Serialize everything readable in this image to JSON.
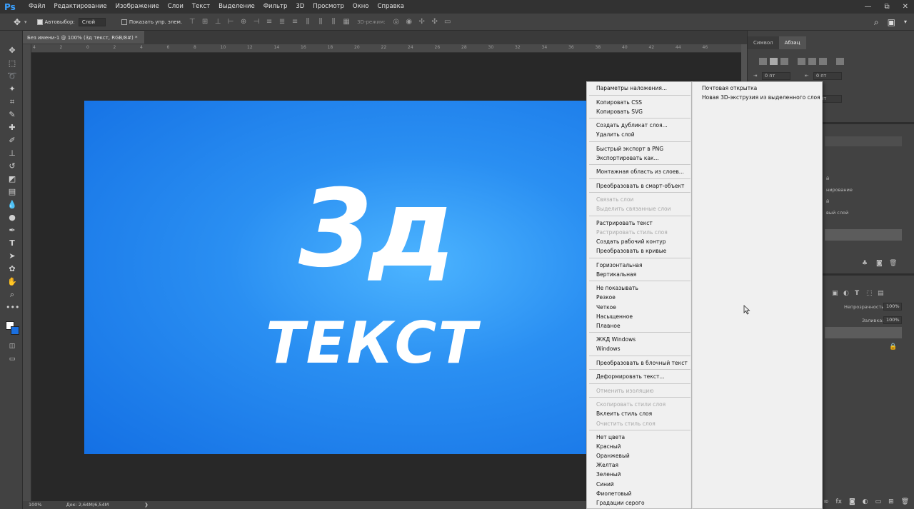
{
  "app": {
    "logo": "Ps",
    "menu": [
      "Файл",
      "Редактирование",
      "Изображение",
      "Слои",
      "Текст",
      "Выделение",
      "Фильтр",
      "3D",
      "Просмотр",
      "Окно",
      "Справка"
    ],
    "window_controls": [
      "—",
      "⧉",
      "✕"
    ]
  },
  "options_bar": {
    "autoselect_label": "Автовыбор:",
    "autoselect_value": "Слой",
    "show_controls_label": "Показать упр. элем.",
    "mode_3d_label": "3D-режим:"
  },
  "document": {
    "tab_title": "Без имени-1 @ 100% (3д текст, RGB/8#) *",
    "ruler_labels": [
      "4",
      "2",
      "0",
      "2",
      "4",
      "6",
      "8",
      "10",
      "12",
      "14",
      "16",
      "18",
      "20",
      "22",
      "24",
      "26",
      "28",
      "30",
      "32",
      "34",
      "36",
      "38",
      "40",
      "42",
      "44",
      "46"
    ],
    "art_line1": "3д",
    "art_line2": "ТЕКСТ",
    "colors": {
      "art_bg_center": "#4cb4ff",
      "art_bg_edge": "#1470e4",
      "art_text": "#ffffff"
    }
  },
  "status_bar": {
    "zoom": "100%",
    "doc_size": "Док: 2,64M/6,54M"
  },
  "right_panel": {
    "tabs": [
      "Символ",
      "Абзац"
    ],
    "active_tab": "Абзац",
    "indent_left": "0 пт",
    "indent_right": "0 пт",
    "indent_first": "0 пт",
    "fragments": [
      "й",
      "нирование",
      "й",
      "вый слой"
    ],
    "opacity_label": "Непрозрачность:",
    "opacity_value": "100%",
    "fill_label": "Заливка:",
    "fill_value": "100%"
  },
  "context_menu": {
    "groups": [
      [
        {
          "label": "Параметры наложения...",
          "enabled": true
        }
      ],
      [
        {
          "label": "Копировать CSS",
          "enabled": true
        },
        {
          "label": "Копировать SVG",
          "enabled": true
        }
      ],
      [
        {
          "label": "Создать дубликат слоя...",
          "enabled": true
        },
        {
          "label": "Удалить слой",
          "enabled": true
        }
      ],
      [
        {
          "label": "Быстрый экспорт в PNG",
          "enabled": true
        },
        {
          "label": "Экспортировать как...",
          "enabled": true
        }
      ],
      [
        {
          "label": "Монтажная область из слоев...",
          "enabled": true
        }
      ],
      [
        {
          "label": "Преобразовать в смарт-объект",
          "enabled": true
        }
      ],
      [
        {
          "label": "Связать слои",
          "enabled": false
        },
        {
          "label": "Выделить связанные слои",
          "enabled": false
        }
      ],
      [
        {
          "label": "Растрировать текст",
          "enabled": true
        },
        {
          "label": "Растрировать стиль слоя",
          "enabled": false
        },
        {
          "label": "Создать рабочий контур",
          "enabled": true
        },
        {
          "label": "Преобразовать в кривые",
          "enabled": true
        }
      ],
      [
        {
          "label": "Горизонтальная",
          "enabled": true
        },
        {
          "label": "Вертикальная",
          "enabled": true
        }
      ],
      [
        {
          "label": "Не показывать",
          "enabled": true
        },
        {
          "label": "Резкое",
          "enabled": true
        },
        {
          "label": "Четкое",
          "enabled": true
        },
        {
          "label": "Насыщенное",
          "enabled": true
        },
        {
          "label": "Плавное",
          "enabled": true
        }
      ],
      [
        {
          "label": "ЖКД Windows",
          "enabled": true
        },
        {
          "label": "Windows",
          "enabled": true
        }
      ],
      [
        {
          "label": "Преобразовать в блочный текст",
          "enabled": true
        }
      ],
      [
        {
          "label": "Деформировать текст...",
          "enabled": true
        }
      ],
      [
        {
          "label": "Отменить изоляцию",
          "enabled": false
        }
      ],
      [
        {
          "label": "Скопировать стили слоя",
          "enabled": false
        },
        {
          "label": "Вклеить стиль слоя",
          "enabled": true
        },
        {
          "label": "Очистить стиль слоя",
          "enabled": false
        }
      ],
      [
        {
          "label": "Нет цвета",
          "enabled": true
        },
        {
          "label": "Красный",
          "enabled": true
        },
        {
          "label": "Оранжевый",
          "enabled": true
        },
        {
          "label": "Желтая",
          "enabled": true
        },
        {
          "label": "Зеленый",
          "enabled": true
        },
        {
          "label": "Синий",
          "enabled": true
        },
        {
          "label": "Фиолетовый",
          "enabled": true
        },
        {
          "label": "Градации серого",
          "enabled": true
        }
      ]
    ]
  },
  "submenu": {
    "items": [
      "Почтовая открытка",
      "Новая 3D-экструзия из выделенного слоя"
    ]
  }
}
